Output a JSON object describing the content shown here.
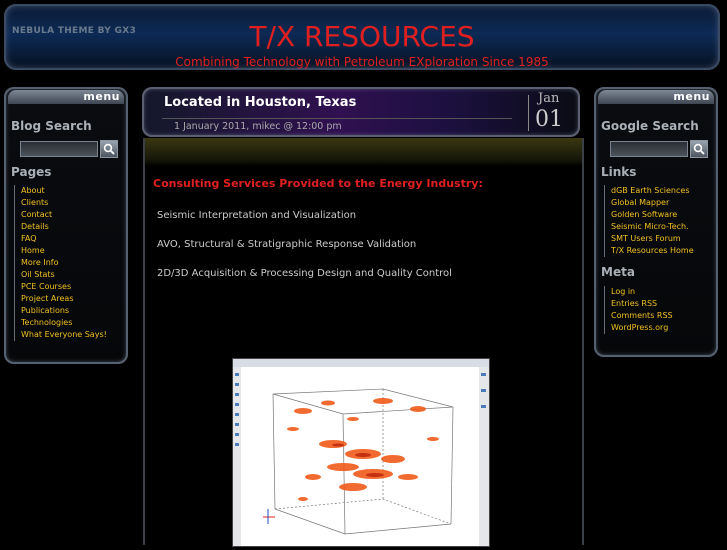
{
  "header": {
    "theme_tag": "NEBULA THEME BY GX3",
    "title": "T/X RESOURCES",
    "subtitle": "Combining Technology with Petroleum EXploration Since 1985"
  },
  "left_sidebar": {
    "menu_label": "menu",
    "blog_search_title": "Blog Search",
    "pages_title": "Pages",
    "pages": [
      "About",
      "Clients",
      "Contact",
      "Details",
      "FAQ",
      "Home",
      "More Info",
      "Oil Stats",
      "PCE Courses",
      "Project Areas",
      "Publications",
      "Technologies",
      "What Everyone Says!"
    ]
  },
  "post": {
    "title": "Located in Houston, Texas",
    "meta": "1 January 2011, mikec @ 12:00 pm",
    "date_month": "Jan",
    "date_day": "01",
    "consult_title": "Consulting Services Provided to the Energy Industry:",
    "services": [
      "Seismic Interpretation and Visualization",
      "AVO, Structural & Stratigraphic Response Validation",
      "2D/3D Acquisition & Processing Design and Quality Control"
    ]
  },
  "right_sidebar": {
    "menu_label": "menu",
    "search_title": "Google Search",
    "links_title": "Links",
    "links": [
      "dGB Earth Sciences",
      "Global Mapper",
      "Golden Software",
      "Seismic Micro-Tech.",
      "SMT Users Forum",
      "T/X Resources Home"
    ],
    "meta_title": "Meta",
    "meta_links": [
      "Log in",
      "Entries RSS",
      "Comments RSS",
      "WordPress.org"
    ]
  },
  "colors": {
    "accent_red": "#e02020",
    "link_yellow": "#f0c020"
  }
}
